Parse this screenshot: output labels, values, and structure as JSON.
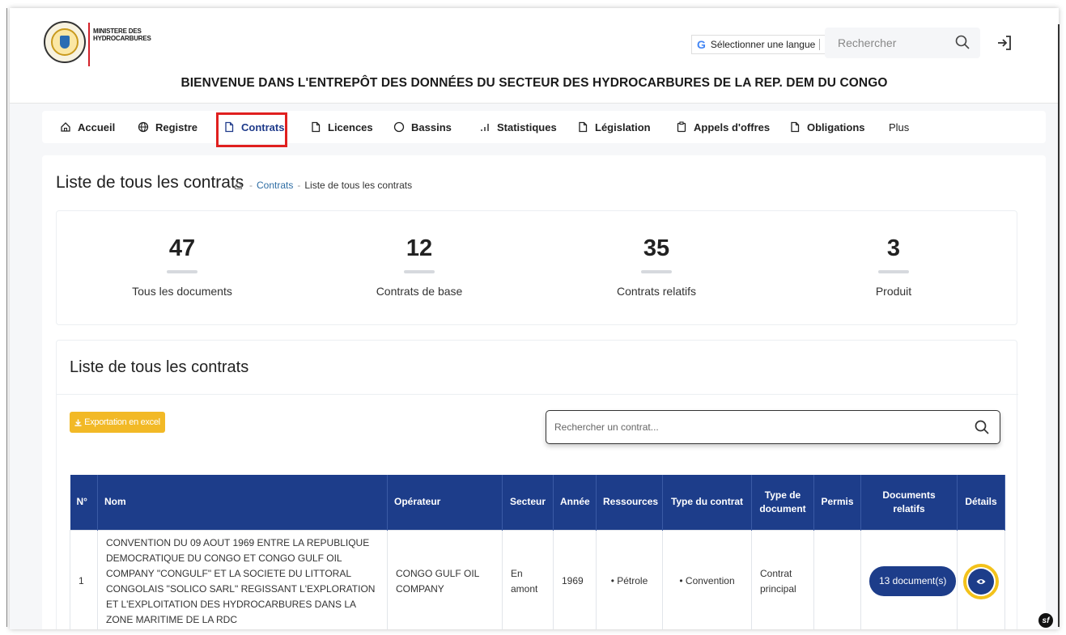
{
  "header": {
    "logo_line1": "MINISTERE DES",
    "logo_line2": "HYDROCARBURES",
    "language_label": "Sélectionner une langue",
    "search_placeholder": "Rechercher",
    "welcome": "BIENVENUE DANS L'ENTREPÔT DES DONNÉES DU SECTEUR DES HYDROCARBURES DE LA REP. DEM DU CONGO"
  },
  "nav": {
    "items": [
      {
        "label": "Accueil",
        "icon": "home-icon"
      },
      {
        "label": "Registre",
        "icon": "globe-icon"
      },
      {
        "label": "Contrats",
        "icon": "document-icon"
      },
      {
        "label": "Licences",
        "icon": "document-icon"
      },
      {
        "label": "Bassins",
        "icon": "circle-icon"
      },
      {
        "label": "Statistiques",
        "icon": "bar-chart-icon"
      },
      {
        "label": "Législation",
        "icon": "document-icon"
      },
      {
        "label": "Appels d'offres",
        "icon": "clipboard-icon"
      },
      {
        "label": "Obligations",
        "icon": "document-icon"
      },
      {
        "label": "Plus"
      }
    ],
    "active": "Contrats",
    "highlight_color": "#e0201f"
  },
  "page": {
    "title": "Liste de tous les contrats",
    "breadcrumb": [
      "Contrats",
      "Liste de tous les contrats"
    ]
  },
  "stats": [
    {
      "value": "47",
      "label": "Tous les documents"
    },
    {
      "value": "12",
      "label": "Contrats de base"
    },
    {
      "value": "35",
      "label": "Contrats relatifs"
    },
    {
      "value": "3",
      "label": "Produit"
    }
  ],
  "list": {
    "title": "Liste de tous les contrats",
    "export_label": "Exportation en excel",
    "search_placeholder": "Rechercher un contrat...",
    "columns": [
      "N°",
      "Nom",
      "Opérateur",
      "Secteur",
      "Année",
      "Ressources",
      "Type du contrat",
      "Type de document",
      "Permis",
      "Documents relatifs",
      "Détails"
    ],
    "rows": [
      {
        "num": "1",
        "nom": "CONVENTION DU 09 AOUT 1969 ENTRE LA REPUBLIQUE DEMOCRATIQUE DU CONGO ET CONGO GULF OIL COMPANY \"CONGULF\" ET LA SOCIETE DU LITTORAL CONGOLAIS \"SOLICO SARL\" REGISSANT L'EXPLORATION ET L'EXPLOITATION DES HYDROCARBURES DANS LA ZONE MARITIME DE LA RDC",
        "operateur": "CONGO GULF OIL COMPANY",
        "secteur": "En amont",
        "annee": "1969",
        "ressources": "Pétrole",
        "type_contrat": "Convention",
        "type_document": "Contrat principal",
        "permis": "",
        "documents": "13 document(s)"
      }
    ]
  },
  "colors": {
    "primary": "#1d3d8a",
    "export": "#f2b926",
    "details_ring": "#f3c21b"
  },
  "badge": "sf"
}
